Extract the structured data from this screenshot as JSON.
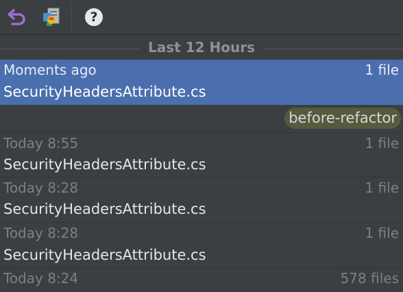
{
  "toolbar": {
    "undo_icon": "undo-icon",
    "revert_icon": "revert-changes-icon",
    "help_icon": "help-icon",
    "help_glyph": "?",
    "colors": {
      "undo": "#9b6fd4",
      "help_bg": "#e8e8e8"
    }
  },
  "section": {
    "title": "Last 12 Hours"
  },
  "entries": [
    {
      "time": "Moments ago",
      "count": "1 file",
      "file": "SecurityHeadersAttribute.cs",
      "selected": true
    },
    {
      "label": "before-refactor"
    },
    {
      "time": "Today 8:55",
      "count": "1 file",
      "file": "SecurityHeadersAttribute.cs"
    },
    {
      "time": "Today 8:28",
      "count": "1 file",
      "file": "SecurityHeadersAttribute.cs"
    },
    {
      "time": "Today 8:28",
      "count": "1 file",
      "file": "SecurityHeadersAttribute.cs"
    },
    {
      "time": "Today 8:24",
      "count": "578 files"
    }
  ],
  "colors": {
    "background": "#3c3f41",
    "selection": "#4b6eaf",
    "label_badge": "#545b3e"
  }
}
